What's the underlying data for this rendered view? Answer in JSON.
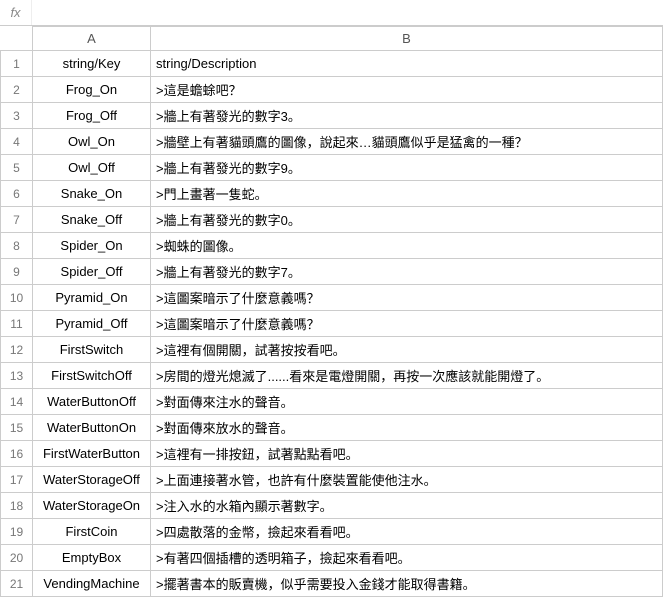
{
  "formula_bar": {
    "fx_label": "fx",
    "value": ""
  },
  "columns": [
    "A",
    "B"
  ],
  "headers": {
    "a": "string/Key",
    "b": "string/Description"
  },
  "rows": [
    {
      "n": "1",
      "a": "string/Key",
      "b": "string/Description"
    },
    {
      "n": "2",
      "a": "Frog_On",
      "b": ">這是蟾蜍吧？"
    },
    {
      "n": "3",
      "a": "Frog_Off",
      "b": ">牆上有著發光的數字3。"
    },
    {
      "n": "4",
      "a": "Owl_On",
      "b": ">牆壁上有著貓頭鷹的圖像，說起來…貓頭鷹似乎是猛禽的一種？"
    },
    {
      "n": "5",
      "a": "Owl_Off",
      "b": ">牆上有著發光的數字9。"
    },
    {
      "n": "6",
      "a": "Snake_On",
      "b": ">門上畫著一隻蛇。"
    },
    {
      "n": "7",
      "a": "Snake_Off",
      "b": ">牆上有著發光的數字0。"
    },
    {
      "n": "8",
      "a": "Spider_On",
      "b": ">蜘蛛的圖像。"
    },
    {
      "n": "9",
      "a": "Spider_Off",
      "b": ">牆上有著發光的數字7。"
    },
    {
      "n": "10",
      "a": "Pyramid_On",
      "b": ">這圖案暗示了什麼意義嗎？"
    },
    {
      "n": "11",
      "a": "Pyramid_Off",
      "b": ">這圖案暗示了什麼意義嗎？"
    },
    {
      "n": "12",
      "a": "FirstSwitch",
      "b": ">這裡有個開關，試著按按看吧。"
    },
    {
      "n": "13",
      "a": "FirstSwitchOff",
      "b": ">房間的燈光熄滅了......看來是電燈開關，再按一次應該就能開燈了。"
    },
    {
      "n": "14",
      "a": "WaterButtonOff",
      "b": ">對面傳來注水的聲音。"
    },
    {
      "n": "15",
      "a": "WaterButtonOn",
      "b": ">對面傳來放水的聲音。"
    },
    {
      "n": "16",
      "a": "FirstWaterButton",
      "b": ">這裡有一排按鈕，試著點點看吧。"
    },
    {
      "n": "17",
      "a": "WaterStorageOff",
      "b": ">上面連接著水管，也許有什麼裝置能使他注水。"
    },
    {
      "n": "18",
      "a": "WaterStorageOn",
      "b": ">注入水的水箱內顯示著數字。"
    },
    {
      "n": "19",
      "a": "FirstCoin",
      "b": ">四處散落的金幣，撿起來看看吧。"
    },
    {
      "n": "20",
      "a": "EmptyBox",
      "b": ">有著四個插槽的透明箱子，撿起來看看吧。"
    },
    {
      "n": "21",
      "a": "VendingMachine",
      "b": ">擺著書本的販賣機，似乎需要投入金錢才能取得書籍。"
    }
  ]
}
